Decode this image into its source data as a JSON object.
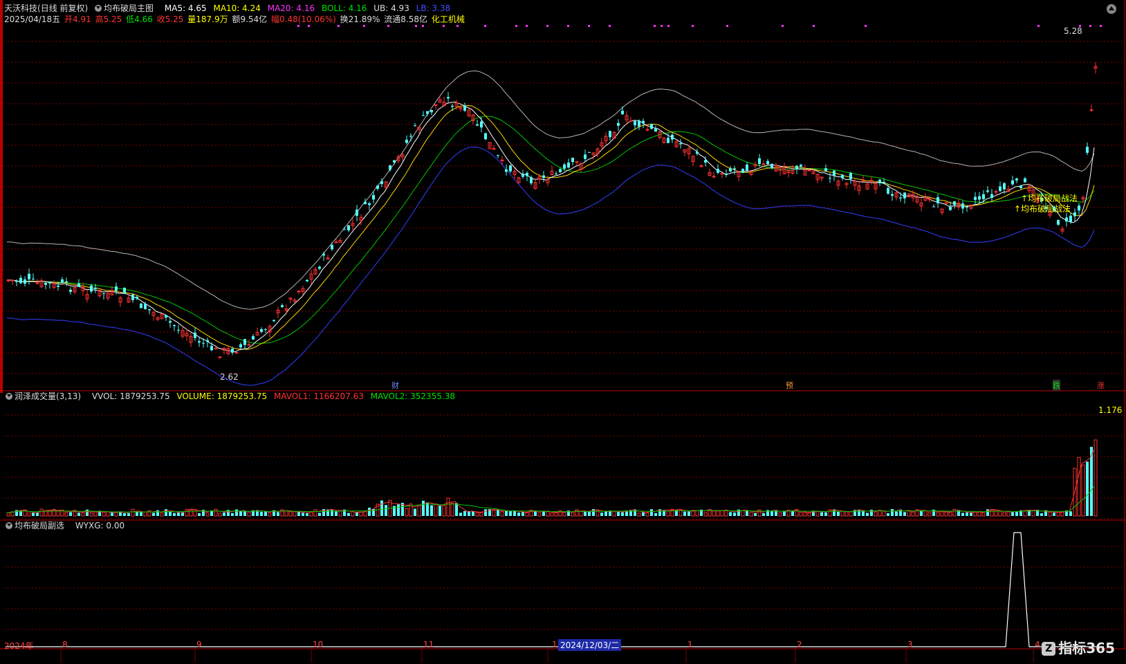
{
  "header": {
    "stock_name": "天沃科技",
    "period_label": "(日线 前复权)",
    "indicator_main": "均布破局主图",
    "ma5_label": "MA5: 4.65",
    "ma10_label": "MA10: 4.24",
    "ma20_label": "MA20: 4.16",
    "boll_label": "BOLL: 4.16",
    "ub_label": "UB: 4.93",
    "lb_label": "LB: 3.38",
    "date": "2025/04/18五",
    "open": "开4.91",
    "high": "高5.25",
    "low": "低4.66",
    "close": "收5.25",
    "volume": "量187.9万",
    "amount": "额9.54亿",
    "change": "幅0.48(10.06%)",
    "turnover": "换21.89%",
    "float_cap": "流通8.58亿",
    "industry": "化工机械"
  },
  "main_chart": {
    "high_marker": "5.28",
    "low_marker": "2.62",
    "signal_label_1": "↑均布破局战法",
    "signal_label_2": "↑均布破局战法",
    "event_markers": [
      "财",
      "预",
      "跌",
      "涨"
    ]
  },
  "volume_panel": {
    "title": "润泽成交量(3,13)",
    "vvol_label": "VVOL: 1879253.75",
    "volume_label": "VOLUME: 1879253.75",
    "mavol1_label": "MAVOL1: 1166207.63",
    "mavol2_label": "MAVOL2: 352355.38",
    "scale_max": "1.176"
  },
  "sub_panel": {
    "title": "均布破局副选",
    "value_label": "WYXG: 0.00"
  },
  "time_axis": {
    "year_label": "2024年",
    "months": [
      "8",
      "9",
      "10",
      "11",
      "1",
      "2",
      "3",
      "4"
    ],
    "cursor_date": "2024/12/03/二",
    "cursor_prefix": "12"
  },
  "logo": {
    "text": "指标365"
  },
  "colors": {
    "up": "#ff3232",
    "down": "#54fcfc",
    "ma5": "#ffffff",
    "ma10": "#ffff00",
    "ma20": "#ff00ff",
    "ub": "#b4b4b4",
    "lb": "#2a35d6",
    "mid": "#00c800",
    "grid": "#8a0000"
  }
}
